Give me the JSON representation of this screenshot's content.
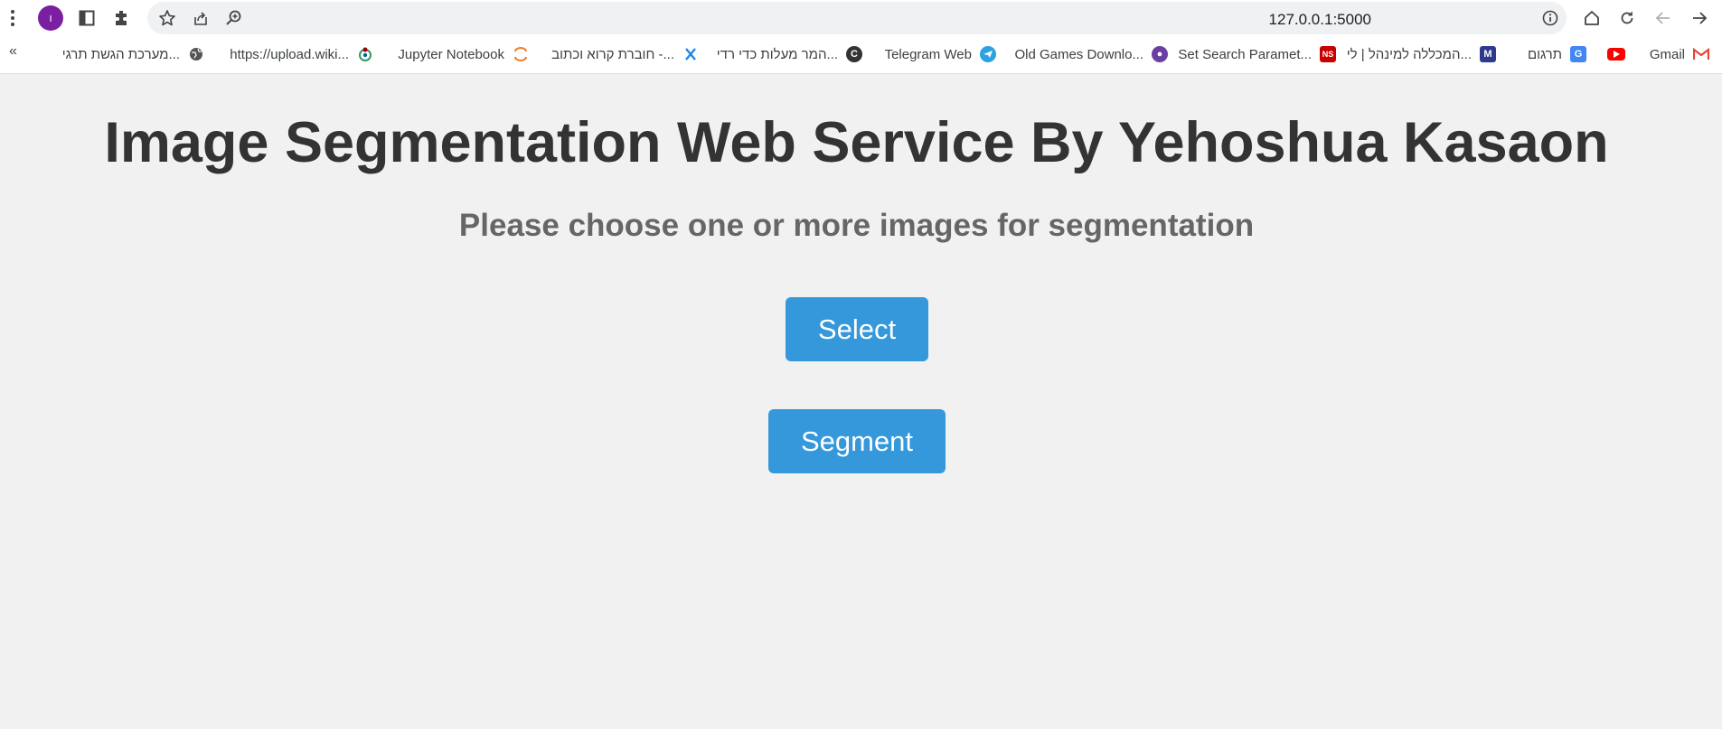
{
  "browser": {
    "url": "127.0.0.1:5000",
    "profile_initial": "ו"
  },
  "bookmarks": [
    {
      "label": "Gmail",
      "icon": "gmail-icon",
      "color": "#ea4335"
    },
    {
      "label": "",
      "icon": "youtube-icon",
      "color": "#ff0000"
    },
    {
      "label": "תרגום",
      "icon": "google-translate-icon",
      "color": "#4285f4"
    },
    {
      "label": "המכללה למינהל | לי...",
      "icon": "college-icon",
      "color": "#2f3a8f"
    },
    {
      "label": "Set Search Paramet...",
      "icon": "ns-icon",
      "color": "#c80000"
    },
    {
      "label": "Old Games Downlo...",
      "icon": "old-games-icon",
      "color": "#6a3fa0"
    },
    {
      "label": "Telegram Web",
      "icon": "telegram-icon",
      "color": "#2aa3e0"
    },
    {
      "label": "המר מעלות כדי רדי...",
      "icon": "converter-icon",
      "color": "#333333"
    },
    {
      "label": "חוברת קרוא וכתוב -...",
      "icon": "x-icon",
      "color": "#1e88e5"
    },
    {
      "label": "Jupyter Notebook",
      "icon": "jupyter-icon",
      "color": "#f37726"
    },
    {
      "label": "https://upload.wiki...",
      "icon": "wikimedia-icon",
      "color": "#339966"
    },
    {
      "label": "מערכת הגשת תרגי...",
      "icon": "globe-icon",
      "color": "#555555"
    }
  ],
  "overflow_label": "«",
  "page": {
    "title": "Image Segmentation Web Service By Yehoshua Kasaon",
    "subtitle": "Please choose one or more images for segmentation",
    "select_button": "Select",
    "segment_button": "Segment"
  },
  "colors": {
    "button": "#3498db",
    "title": "#333333",
    "subtitle": "#666666",
    "background": "#f1f1f1"
  }
}
